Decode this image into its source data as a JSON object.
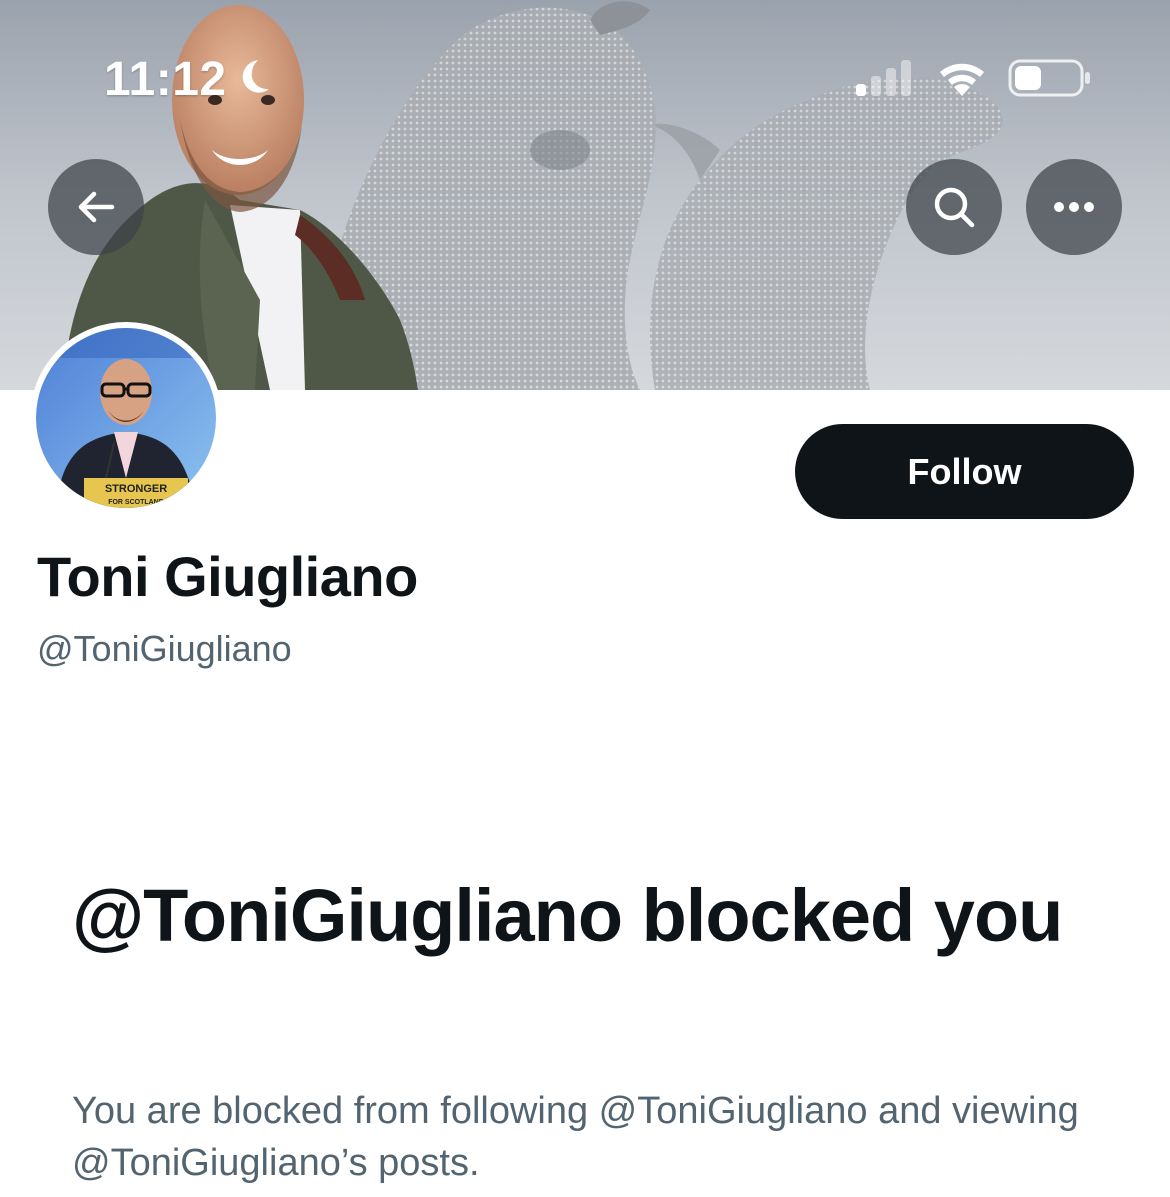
{
  "status_bar": {
    "time": "11:12",
    "icons": [
      "moon-icon",
      "cellular-signal-icon",
      "wifi-icon",
      "battery-icon"
    ]
  },
  "header": {
    "back_icon": "arrow-left-icon",
    "search_icon": "search-icon",
    "more_icon": "more-horizontal-icon"
  },
  "avatar": {
    "podium_text_1": "STRONGER",
    "podium_text_2": "FOR SCOTLAND"
  },
  "profile": {
    "display_name": "Toni Giugliano",
    "handle": "@ToniGiugliano",
    "follow_label": "Follow"
  },
  "blocked": {
    "heading": "@ToniGiugliano blocked you",
    "description": "You are blocked from following @ToniGiugliano and viewing @ToniGiugliano’s posts."
  },
  "colors": {
    "primary_text": "#0f1419",
    "secondary_text": "#536471",
    "button_bg": "#0f1419",
    "button_text": "#ffffff",
    "overlay_button": "#3c4248"
  }
}
